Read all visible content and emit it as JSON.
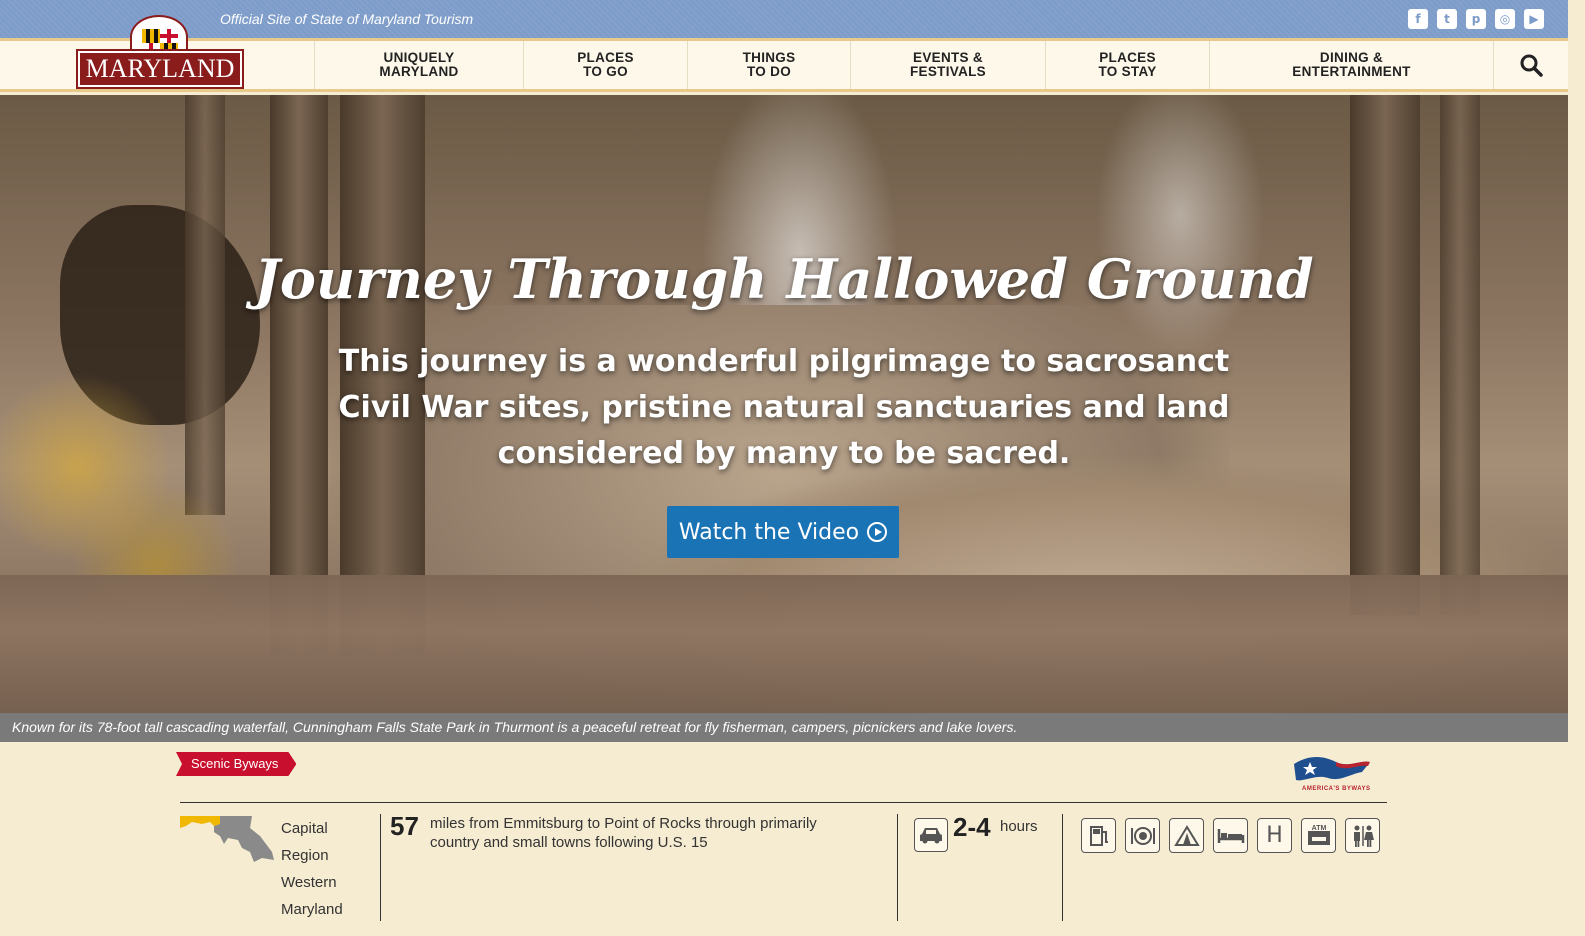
{
  "topbar": {
    "official_text": "Official Site of State of Maryland Tourism",
    "social": [
      "facebook-icon",
      "twitter-icon",
      "pinterest-icon",
      "instagram-icon",
      "youtube-icon"
    ]
  },
  "logo": {
    "text": "MARYLAND"
  },
  "nav": {
    "items": [
      {
        "line1": "UNIQUELY",
        "line2": "MARYLAND"
      },
      {
        "line1": "PLACES",
        "line2": "TO GO"
      },
      {
        "line1": "THINGS",
        "line2": "TO DO"
      },
      {
        "line1": "EVENTS &",
        "line2": "FESTIVALS"
      },
      {
        "line1": "PLACES",
        "line2": "TO STAY"
      },
      {
        "line1": "DINING &",
        "line2": "ENTERTAINMENT"
      }
    ],
    "search_icon": "search-icon"
  },
  "hero": {
    "title": "Journey Through Hallowed Ground",
    "subtitle": "This journey is a wonderful pilgrimage to sacrosanct Civil War sites, pristine natural sanctuaries and land considered by many to be sacred.",
    "button_label": "Watch the Video",
    "caption": "Known for its 78-foot tall cascading waterfall, Cunningham Falls State Park in Thurmont is a peaceful retreat for fly fisherman, campers, picnickers and lake lovers."
  },
  "byway": {
    "tag": "Scenic Byways",
    "logo_caption": "AMERICA'S BYWAYS",
    "regions": [
      "Capital",
      "Region",
      "Western",
      "Maryland"
    ],
    "miles": "57",
    "miles_text": "miles from Emmitsburg to Point of Rocks through primarily country and small towns following U.S. 15",
    "hours": "2-4",
    "hours_text": "hours",
    "amenities": [
      "gas-icon",
      "dining-icon",
      "camping-icon",
      "lodging-icon",
      "hospital-icon",
      "atm-icon",
      "restroom-icon"
    ],
    "hospital_letter": "H",
    "atm_label": "ATM"
  },
  "colors": {
    "topbar": "#7d9cc9",
    "brand_red": "#8a1c1c",
    "tag_red": "#c8102e",
    "button_blue": "#1a73b4",
    "page_bg": "#f6ecd2"
  }
}
